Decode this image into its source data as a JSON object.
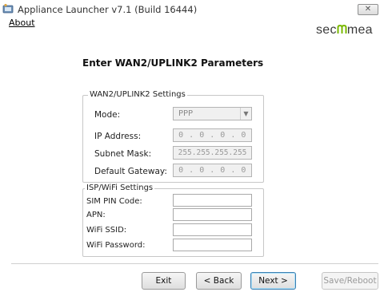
{
  "window": {
    "title": "Appliance Launcher v7.1 (Build 16444)",
    "close_glyph": "✕"
  },
  "menu": {
    "about": "About"
  },
  "brand": {
    "logo_prefix": "sec",
    "logo_suffix": "mea",
    "logo_accent_color": "#7ab800"
  },
  "page": {
    "heading": "Enter WAN2/UPLINK2 Parameters"
  },
  "wan_group": {
    "legend": "WAN2/UPLINK2 Settings",
    "mode_label": "Mode:",
    "mode_value": "PPP",
    "ip_label": "IP Address:",
    "ip_value": "0 . 0 . 0 . 0",
    "subnet_label": "Subnet Mask:",
    "subnet_value": "255.255.255.255",
    "gateway_label": "Default Gateway:",
    "gateway_value": "0 . 0 . 0 . 0"
  },
  "isp_group": {
    "legend": "ISP/WiFi Settings",
    "sim_label": "SIM PIN Code:",
    "apn_label": "APN:",
    "ssid_label": "WiFi SSID:",
    "password_label": "WiFi Password:"
  },
  "buttons": {
    "exit": "Exit",
    "back": "< Back",
    "next": "Next >",
    "save_reboot": "Save/Reboot"
  }
}
